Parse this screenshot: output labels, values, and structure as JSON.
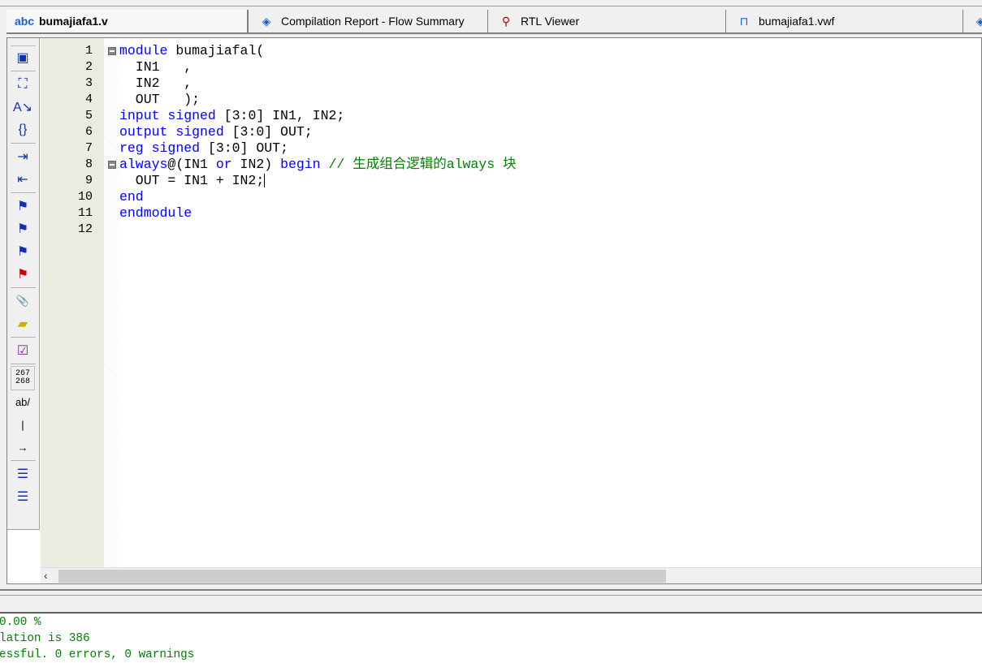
{
  "tabs": [
    {
      "label": "bumajiafa1.v",
      "icon": "verilog-file-icon",
      "active": true
    },
    {
      "label": "Compilation Report - Flow Summary",
      "icon": "report-icon"
    },
    {
      "label": "RTL Viewer",
      "icon": "rtl-viewer-icon"
    },
    {
      "label": "bumajiafa1.vwf",
      "icon": "waveform-file-icon"
    }
  ],
  "toolbar": [
    {
      "icon": "insert-template-icon",
      "glyph": "▣"
    },
    "sep",
    {
      "icon": "find-binoculars-icon",
      "glyph": "⛶"
    },
    {
      "icon": "find-replace-icon",
      "glyph": "A↘"
    },
    {
      "icon": "goto-brace-icon",
      "glyph": "{}"
    },
    "sep",
    {
      "icon": "indent-icon",
      "glyph": "⇥"
    },
    {
      "icon": "unindent-icon",
      "glyph": "⇤"
    },
    "sep",
    {
      "icon": "toggle-bookmark-icon",
      "glyph": "⚑"
    },
    {
      "icon": "next-bookmark-icon",
      "glyph": "⚑"
    },
    {
      "icon": "previous-bookmark-icon",
      "glyph": "⚑"
    },
    {
      "icon": "clear-bookmarks-icon",
      "glyph": "⚑"
    },
    "sep",
    {
      "icon": "attach-icon",
      "glyph": "📎"
    },
    {
      "icon": "script-icon",
      "glyph": "▰"
    },
    "sep",
    {
      "icon": "check-syntax-icon",
      "glyph": "☑"
    },
    "sep",
    {
      "icon": "line-numbers-icon",
      "glyph": "267 268"
    },
    {
      "icon": "text-wrap-icon",
      "glyph": "ab/"
    },
    {
      "icon": "vertical-line-icon",
      "glyph": "|"
    },
    {
      "icon": "whitespace-icon",
      "glyph": "→"
    },
    "sep",
    {
      "icon": "comment-icon",
      "glyph": "☰"
    },
    {
      "icon": "uncomment-icon",
      "glyph": "☰"
    }
  ],
  "code": [
    {
      "n": "1",
      "fold": true,
      "tokens": [
        [
          "kw",
          "module"
        ],
        [
          "t",
          " bumajiafal("
        ]
      ]
    },
    {
      "n": "2",
      "tokens": [
        [
          "t",
          "  IN1   ,"
        ]
      ]
    },
    {
      "n": "3",
      "tokens": [
        [
          "t",
          "  IN2   ,"
        ]
      ]
    },
    {
      "n": "4",
      "tokens": [
        [
          "t",
          "  OUT   );"
        ]
      ]
    },
    {
      "n": "5",
      "tokens": [
        [
          "kw",
          "input"
        ],
        [
          "t",
          " "
        ],
        [
          "kw",
          "signed"
        ],
        [
          "t",
          " [3:0] IN1, IN2;"
        ]
      ]
    },
    {
      "n": "6",
      "tokens": [
        [
          "kw",
          "output"
        ],
        [
          "t",
          " "
        ],
        [
          "kw",
          "signed"
        ],
        [
          "t",
          " [3:0] OUT;"
        ]
      ]
    },
    {
      "n": "7",
      "tokens": [
        [
          "kw",
          "reg"
        ],
        [
          "t",
          " "
        ],
        [
          "kw",
          "signed"
        ],
        [
          "t",
          " [3:0] OUT;"
        ]
      ]
    },
    {
      "n": "8",
      "fold": true,
      "tokens": [
        [
          "kw",
          "always"
        ],
        [
          "t",
          "@(IN1 "
        ],
        [
          "kw",
          "or"
        ],
        [
          "t",
          " IN2) "
        ],
        [
          "kw",
          "begin"
        ],
        [
          "t",
          " "
        ],
        [
          "cm",
          "// 生成组合逻辑的always 块"
        ]
      ]
    },
    {
      "n": "9",
      "cursor": true,
      "tokens": [
        [
          "t",
          "  OUT = IN1 + IN2;"
        ]
      ]
    },
    {
      "n": "10",
      "tokens": [
        [
          "kw",
          "end"
        ]
      ]
    },
    {
      "n": "11",
      "tokens": [
        [
          "kw",
          "endmodule"
        ]
      ]
    },
    {
      "n": "12",
      "tokens": []
    }
  ],
  "messages": [
    "0.00 %",
    "lation is 386",
    "essful. 0 errors, 0 warnings"
  ],
  "colors": {
    "keyword": "#0000ff",
    "comment": "#008000",
    "message": "#008000",
    "gutter": "#ebebdf"
  }
}
